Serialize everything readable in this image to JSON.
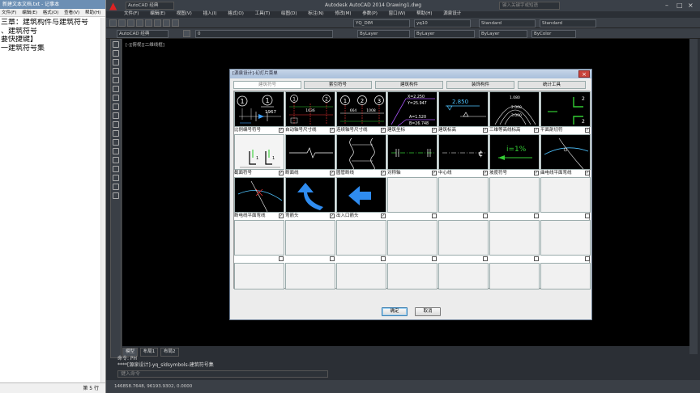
{
  "notepad": {
    "title": "新建文本文档.txt - 记事本",
    "menu": [
      "文件(F)",
      "编辑(E)",
      "格式(O)",
      "查看(V)",
      "帮助(H)"
    ],
    "lines": [
      "三章：建筑构件与建筑符号",
      "、建筑符号",
      "要快捷键】",
      "一建筑符号集"
    ],
    "status": "第 5 行"
  },
  "acad": {
    "title": "Autodesk AutoCAD 2014    Drawing1.dwg",
    "workspace": "AutoCAD 经典",
    "search_placeholder": "键入关键字或短语",
    "menu": [
      "文件(F)",
      "编辑(E)",
      "视图(V)",
      "插入(I)",
      "格式(O)",
      "工具(T)",
      "绘图(D)",
      "标注(N)",
      "修改(M)",
      "参数(P)",
      "窗口(W)",
      "帮助(H)",
      "源泉设计"
    ],
    "dim_style": "YQ_DIM",
    "text_style": "yq10",
    "style1": "Standard",
    "style2": "Standard",
    "layer": "0",
    "color": "ByLayer",
    "linetype": "ByLayer",
    "lineweight": "ByLayer",
    "plotstyle": "ByColor",
    "viewport_label": "[-][俯视][二维线框]",
    "layout_tabs": [
      "模型",
      "布局1",
      "布局2"
    ],
    "cmd_line1": "命令: PH",
    "cmd_line2": "****[源泉设计]-yq_sldsymbols-建筑符号集",
    "cmd_prompt": "键入命令",
    "coords": "146858.7648, 96193.9302, 0.0000"
  },
  "dialog": {
    "title": "[源泉设计]-幻灯片菜单",
    "close": "×",
    "tabs": [
      {
        "label": "建筑符号",
        "active": true
      },
      {
        "label": "索引符号",
        "active": false
      },
      {
        "label": "建筑构件",
        "active": false
      },
      {
        "label": "装饰构件",
        "active": false
      },
      {
        "label": "统计工具",
        "active": false
      }
    ],
    "items": [
      {
        "label": "比例编号符号",
        "type": "scale-number"
      },
      {
        "label": "自动轴号尺寸线",
        "type": "auto-axis-dim"
      },
      {
        "label": "连续轴号尺寸线",
        "type": "continuous-axis-dim"
      },
      {
        "label": "建筑坐标",
        "type": "coordinate"
      },
      {
        "label": "建筑标高",
        "type": "elevation"
      },
      {
        "label": "三维等高线标高",
        "type": "contour-elevation"
      },
      {
        "label": "平面剖切符",
        "type": "section-mark"
      },
      {
        "label": "截面符号",
        "type": "cross-section"
      },
      {
        "label": "断面线",
        "type": "break-line"
      },
      {
        "label": "圆管断线",
        "type": "pipe-break"
      },
      {
        "label": "对称轴",
        "type": "symmetry-axis"
      },
      {
        "label": "中心线",
        "type": "center-line"
      },
      {
        "label": "坡度符号",
        "type": "slope"
      },
      {
        "label": "曲电线平面弯线",
        "type": "curve-bend"
      },
      {
        "label": "断电线平面弯线",
        "type": "break-bend"
      },
      {
        "label": "弯箭头",
        "type": "bent-arrow"
      },
      {
        "label": "出入口箭头",
        "type": "entrance-arrow"
      }
    ],
    "texts": {
      "coord_x": "X=2.250",
      "coord_y": "Y=25.947",
      "coord_a": "A=1.520",
      "coord_b": "B=26.748",
      "elev": "2.850",
      "contour1": "1.080",
      "contour2": "2.000",
      "contour3": "3.000",
      "slope": "i=1%",
      "dim1": "664",
      "dim2": "1008",
      "scale": "1967"
    },
    "ok_label": "确定",
    "cancel_label": "取消"
  }
}
